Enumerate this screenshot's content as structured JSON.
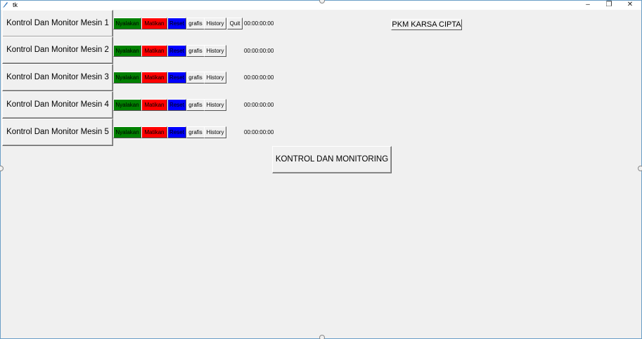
{
  "window": {
    "title": "tk",
    "minimize_symbol": "–",
    "maximize_symbol": "❐",
    "close_symbol": "✕",
    "border_color": "#6a9ec7"
  },
  "machines": [
    {
      "label": "Kontrol Dan Monitor Mesin 1",
      "timer": "00:00:00:00"
    },
    {
      "label": "Kontrol Dan Monitor Mesin 2",
      "timer": "00:00:00:00"
    },
    {
      "label": "Kontrol Dan Monitor Mesin 3",
      "timer": "00:00:00:00"
    },
    {
      "label": "Kontrol Dan Monitor Mesin 4",
      "timer": "00:00:00:00"
    },
    {
      "label": "Kontrol Dan Monitor Mesin 5",
      "timer": "00:00:00:00"
    }
  ],
  "controls": {
    "on_label": "Nyalakan",
    "off_label": "Matikan",
    "reset_label": "Reset",
    "grafis_label": "grafis",
    "history_label": "History",
    "quit_label": "Quit",
    "on_color": "#008000",
    "off_color": "#ff0000",
    "reset_color": "#0000ff"
  },
  "pkm_button_label": "PKM KARSA CIPTA",
  "main_button_label": "KONTROL DAN MONITORING"
}
